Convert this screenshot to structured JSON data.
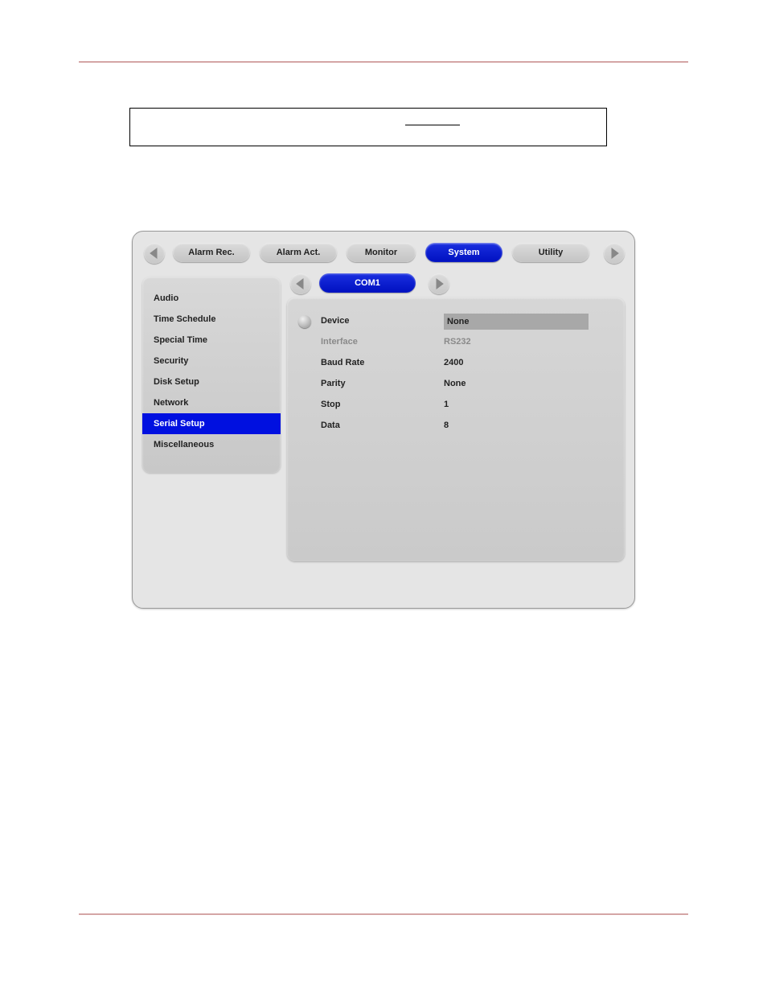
{
  "tabs": {
    "items": [
      "Alarm Rec.",
      "Alarm Act.",
      "Monitor",
      "System",
      "Utility"
    ],
    "active_index": 3
  },
  "sub_tab": "COM1",
  "sidebar": {
    "items": [
      "Audio",
      "Time Schedule",
      "Special Time",
      "Security",
      "Disk Setup",
      "Network",
      "Serial Setup",
      "Miscellaneous"
    ],
    "active_index": 6
  },
  "settings": [
    {
      "label": "Device",
      "value": "None",
      "radio": true,
      "highlight": true,
      "disabled": false
    },
    {
      "label": "Interface",
      "value": "RS232",
      "radio": false,
      "highlight": false,
      "disabled": true
    },
    {
      "label": "Baud Rate",
      "value": "2400",
      "radio": false,
      "highlight": false,
      "disabled": false
    },
    {
      "label": "Parity",
      "value": "None",
      "radio": false,
      "highlight": false,
      "disabled": false
    },
    {
      "label": "Stop",
      "value": "1",
      "radio": false,
      "highlight": false,
      "disabled": false
    },
    {
      "label": "Data",
      "value": "8",
      "radio": false,
      "highlight": false,
      "disabled": false
    }
  ]
}
